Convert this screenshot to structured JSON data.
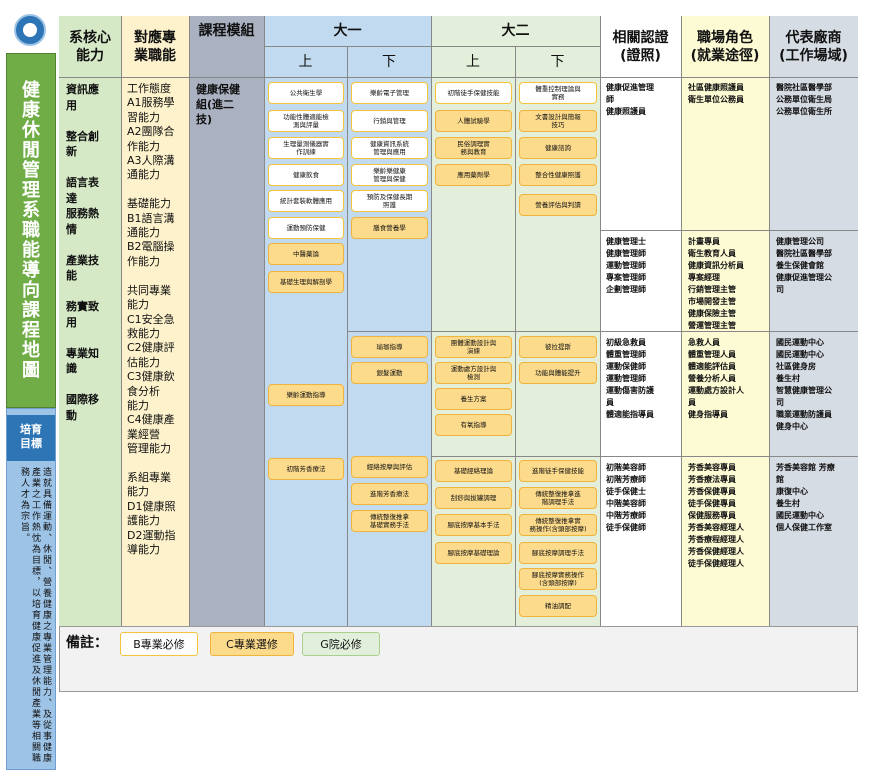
{
  "left_panel": {
    "title": "健康休閒管理系職能導向課程地圖",
    "goal_label": "培育\n目標",
    "goal_text": "造就具備運動、休閒、營養健康之專業管理能力、及從事健康產業之工作熱忱為目標，以培育健康促進及休閒產業等相關職務人才為宗旨。"
  },
  "headers": {
    "core": "系核心\n能力",
    "competency": "對應專\n業職能",
    "module": "課程模組",
    "year1": "大一",
    "year2": "大二",
    "sem1": "上",
    "sem2": "下",
    "cert": "相關認證\n(證照)",
    "role": "職場角色\n(就業途徑)",
    "firm": "代表廠商\n(工作場域)"
  },
  "core_abilities": "資訊應\n用\n\n整合創\n新\n\n語言表\n達\n服務熱\n情\n\n產業技\n能\n\n務實致\n用\n\n專業知\n識\n\n國際移\n動",
  "competencies": "工作態度\nA1服務學\n習能力\nA2團隊合\n作能力\nA3人際溝\n通能力\n\n基礎能力\nB1語言溝\n通能力\nB2電腦操\n作能力\n\n共同專業\n能力\nC1安全急\n救能力\nC2健康評\n估能力\nC3健康飲\n食分析\n能力\nC4健康產\n業經營\n管理能力\n\n系組專業\n能力\nD1健康照\n護能力\nD2運動指\n導能力",
  "module_name": "健康保健\n組(進二\n技)",
  "courses": {
    "y1s1": [
      {
        "t": "公共衛生學",
        "k": "B"
      },
      {
        "t": "功能性體適能檢\n測與評量",
        "k": "B"
      },
      {
        "t": "生理量測儀器實\n作訓練",
        "k": "B"
      },
      {
        "t": "健康飲食",
        "k": "B"
      },
      {
        "t": "統計套裝軟體應用",
        "k": "B"
      },
      {
        "t": "運動預防保健",
        "k": "B"
      },
      {
        "t": "中醫藥論",
        "k": "C"
      },
      {
        "t": "基礎生理與解剖學",
        "k": "C"
      },
      {
        "t": "樂齡運動指導",
        "k": "C"
      },
      {
        "t": "初階芳香療法",
        "k": "C"
      }
    ],
    "y1s2": [
      {
        "t": "樂齡電子管理",
        "k": "B"
      },
      {
        "t": "行銷與管理",
        "k": "B"
      },
      {
        "t": "健康資訊系統\n管理與應用",
        "k": "B"
      },
      {
        "t": "樂齡樂健康\n管理與保健",
        "k": "B"
      },
      {
        "t": "預防及保健長期\n照護",
        "k": "B"
      },
      {
        "t": "膳食營養學",
        "k": "C"
      },
      {
        "t": "瑜珈指導",
        "k": "C"
      },
      {
        "t": "銀髮運動",
        "k": "C"
      },
      {
        "t": "經絡按摩與評估",
        "k": "C"
      },
      {
        "t": "進階芳香療法",
        "k": "C"
      },
      {
        "t": "傳統整復推拿\n基礎實務手法",
        "k": "C"
      }
    ],
    "y2s1": [
      {
        "t": "初階徒手保健技能",
        "k": "B"
      },
      {
        "t": "人體試驗學",
        "k": "C"
      },
      {
        "t": "民俗調理實\n務與教育",
        "k": "C"
      },
      {
        "t": "應用藥劑學",
        "k": "C"
      },
      {
        "t": "團體運動設計與\n演練",
        "k": "C"
      },
      {
        "t": "運動處方設計與\n檢測",
        "k": "C"
      },
      {
        "t": "養生方案",
        "k": "C"
      },
      {
        "t": "有氧指導",
        "k": "C"
      },
      {
        "t": "基礎經絡理論",
        "k": "C"
      },
      {
        "t": "刮痧與拔罐調理",
        "k": "C"
      },
      {
        "t": "腳底按摩基本手法",
        "k": "C"
      },
      {
        "t": "腳底按摩基礎理論",
        "k": "C"
      }
    ],
    "y2s2": [
      {
        "t": "體重控制理論與\n實務",
        "k": "B"
      },
      {
        "t": "文書設計與簡報\n技巧",
        "k": "C"
      },
      {
        "t": "健康諮詢",
        "k": "C"
      },
      {
        "t": "整合性健康照護",
        "k": "C"
      },
      {
        "t": "營養評估與判讀",
        "k": "C"
      },
      {
        "t": "彼拉提斯",
        "k": "C"
      },
      {
        "t": "功能與體能提升",
        "k": "C"
      },
      {
        "t": "進階徒手保健技能",
        "k": "C"
      },
      {
        "t": "傳統整復推拿進\n階調理手法",
        "k": "C"
      },
      {
        "t": "傳統整復推拿實\n務操作(含頭部按摩)",
        "k": "C"
      },
      {
        "t": "腳底按摩調理手法",
        "k": "C"
      },
      {
        "t": "腳底按摩實務操作\n(含頭部按摩)",
        "k": "C"
      },
      {
        "t": "精油調配",
        "k": "C"
      }
    ]
  },
  "rows": [
    {
      "cert": "健康促進管理\n師\n健康照護員",
      "role": "社區健康照護員\n衛生單位公務員",
      "firm": "醫院社區醫學部\n公務單位衛生局\n公務單位衛生所"
    },
    {
      "cert": "健康管理士\n健康管理師\n運動管理師\n專案管理師\n企劃管理師",
      "role": "計畫專員\n衛生教育人員\n健康資訊分析員\n專案經理\n行銷管理主管\n市場開發主管\n健康保險主管\n營運管理主管",
      "firm": "健康管理公司\n醫院社區醫學部\n養生保健會館\n健康促進管理公\n司"
    },
    {
      "cert": "初級急救員\n體重管理師\n運動保健師\n運動管理師\n運動傷害防護\n員\n體適能指導員",
      "role": "急救人員\n體重管理人員\n體適能評估員\n營養分析人員\n運動處方設計人\n員\n健身指導員",
      "firm": "國民運動中心\n國民運動中心\n社區健身房\n養生村\n智慧健康管理公\n司\n職業運動防護員\n健身中心"
    },
    {
      "cert": "初階美容師\n初階芳療師\n徒手保健士\n中階美容師\n中階芳療師\n徒手保健師",
      "role": "芳香美容專員\n芳香療法專員\n芳香保健專員\n徒手保健專員\n保健服務專員\n芳香美容經理人\n芳香療程經理人\n芳香保健經理人\n徒手保健經理人",
      "firm": "芳香美容館 芳療\n館\n康復中心\n養生村\n國民運動中心\n個人保健工作室"
    }
  ],
  "notes": {
    "label": "備註：",
    "legend_b": "B專業必修",
    "legend_c": "C專業選修",
    "legend_g": "G院必修"
  },
  "colors": {
    "green_header": "#d6e9c6",
    "yellow_col": "#fdf2cc",
    "gray_module": "#aab2c2",
    "blue_y1": "#c2daf0",
    "green_y2": "#e3efda",
    "cert_bg": "#ffffff",
    "role_bg": "#fdfbd4",
    "firm_bg": "#d6dce4",
    "side_green": "#70ad47",
    "side_blue": "#9dc3e6"
  }
}
